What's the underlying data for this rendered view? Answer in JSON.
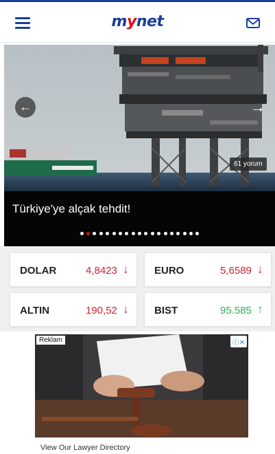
{
  "header": {
    "logo_text_1": "m",
    "logo_text_2": "y",
    "logo_text_3": "net",
    "menu_icon": "hamburger-icon",
    "mail_icon": "envelope-icon"
  },
  "slider": {
    "caption": "Türkiye'ye alçak tehdit!",
    "comments": "61 yorum",
    "prev_icon": "arrow-left-icon",
    "next_icon": "arrow-right-icon",
    "prev_glyph": "←",
    "next_glyph": "→",
    "total_slides": 19,
    "active_slide": 2
  },
  "rates": [
    {
      "name": "DOLAR",
      "value": "4,8423",
      "trend": "down",
      "arrow": "↓",
      "color": "#d4202c"
    },
    {
      "name": "EURO",
      "value": "5,6589",
      "trend": "down",
      "arrow": "↓",
      "color": "#d4202c"
    },
    {
      "name": "ALTIN",
      "value": "190,52",
      "trend": "down",
      "arrow": "↓",
      "color": "#d4202c"
    },
    {
      "name": "BIST",
      "value": "95.585",
      "trend": "up",
      "arrow": "↑",
      "color": "#31b14b"
    }
  ],
  "ad": {
    "label": "Reklam",
    "choices": "ⓘ✕",
    "text": "View Our Lawyer Directory"
  },
  "colors": {
    "brand_blue": "#1a3f98",
    "brand_red": "#e30613",
    "down_red": "#d4202c",
    "up_green": "#31b14b"
  }
}
